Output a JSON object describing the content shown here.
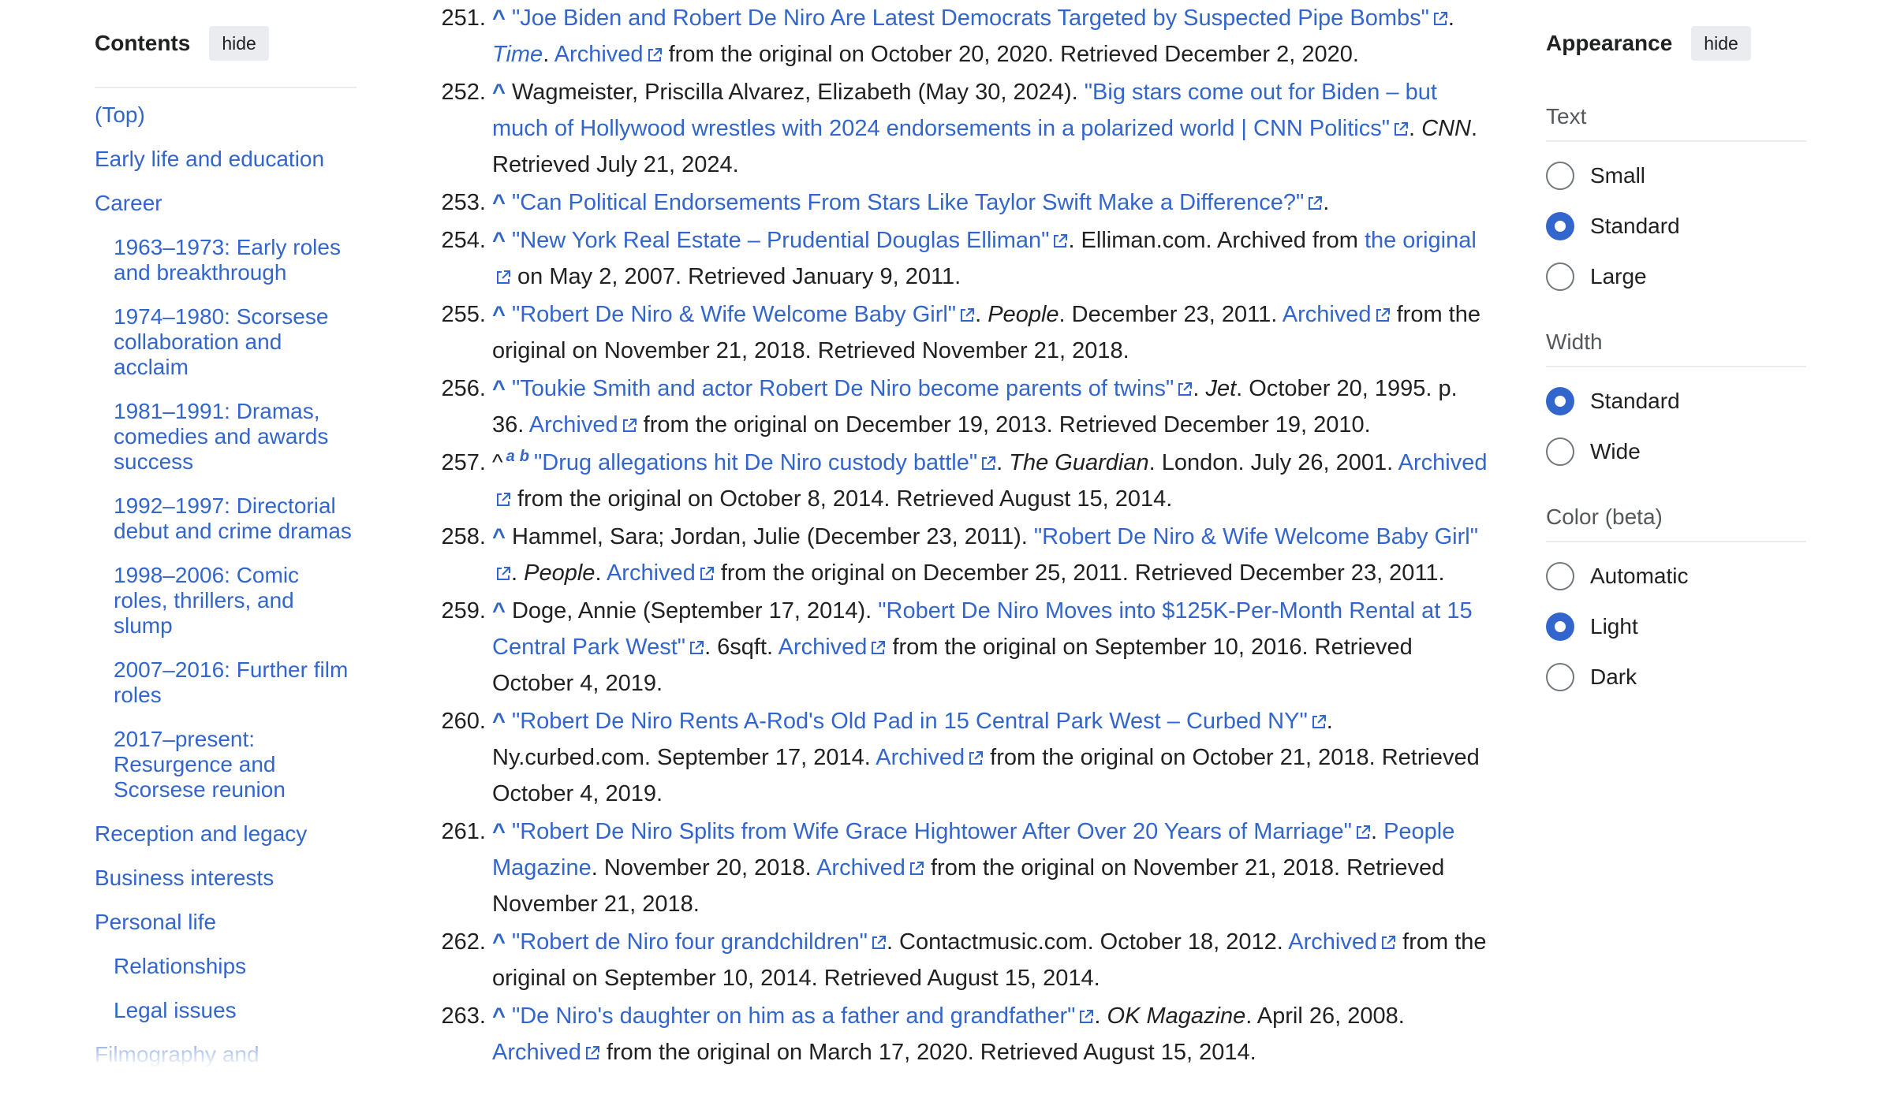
{
  "toc": {
    "title": "Contents",
    "hide_label": "hide",
    "items": [
      {
        "label": "(Top)",
        "level": 1
      },
      {
        "label": "Early life and education",
        "level": 1
      },
      {
        "label": "Career",
        "level": 1,
        "expandable": true
      },
      {
        "label": "1963–1973: Early roles and breakthrough",
        "level": 2
      },
      {
        "label": "1974–1980: Scorsese collaboration and acclaim",
        "level": 2
      },
      {
        "label": "1981–1991: Dramas, comedies and awards success",
        "level": 2
      },
      {
        "label": "1992–1997: Directorial debut and crime dramas",
        "level": 2
      },
      {
        "label": "1998–2006: Comic roles, thrillers, and slump",
        "level": 2
      },
      {
        "label": "2007–2016: Further film roles",
        "level": 2
      },
      {
        "label": "2017–present: Resurgence and Scorsese reunion",
        "level": 2
      },
      {
        "label": "Reception and legacy",
        "level": 1
      },
      {
        "label": "Business interests",
        "level": 1
      },
      {
        "label": "Personal life",
        "level": 1,
        "expandable": true
      },
      {
        "label": "Relationships",
        "level": 2
      },
      {
        "label": "Legal issues",
        "level": 2
      },
      {
        "label": "Filmography and",
        "level": 1
      }
    ]
  },
  "appearance": {
    "title": "Appearance",
    "hide_label": "hide",
    "sections": [
      {
        "label": "Text",
        "options": [
          {
            "label": "Small",
            "checked": false
          },
          {
            "label": "Standard",
            "checked": true
          },
          {
            "label": "Large",
            "checked": false
          }
        ]
      },
      {
        "label": "Width",
        "options": [
          {
            "label": "Standard",
            "checked": true
          },
          {
            "label": "Wide",
            "checked": false
          }
        ]
      },
      {
        "label": "Color (beta)",
        "options": [
          {
            "label": "Automatic",
            "checked": false
          },
          {
            "label": "Light",
            "checked": true
          },
          {
            "label": "Dark",
            "checked": false
          }
        ]
      }
    ]
  },
  "references": [
    {
      "num": "251.",
      "caret": "^",
      "segments": [
        {
          "t": "\"Joe Biden and Robert De Niro Are Latest Democrats Targeted by Suspected Pipe Bombs\"",
          "link": true,
          "ext": true
        },
        {
          "t": ". "
        },
        {
          "t": "Time",
          "link": true,
          "italic": true
        },
        {
          "t": ". "
        },
        {
          "t": "Archived",
          "link": true,
          "ext": true
        },
        {
          "t": " from the original on October 20, 2020. Retrieved December 2, 2020."
        }
      ]
    },
    {
      "num": "252.",
      "caret": "^",
      "segments": [
        {
          "t": "Wagmeister, Priscilla Alvarez, Elizabeth (May 30, 2024). "
        },
        {
          "t": "\"Big stars come out for Biden – but much of Hollywood wrestles with 2024 endorsements in a polarized world | CNN Politics\"",
          "link": true,
          "ext": true
        },
        {
          "t": ". "
        },
        {
          "t": "CNN",
          "italic": true
        },
        {
          "t": ". Retrieved July 21, 2024."
        }
      ]
    },
    {
      "num": "253.",
      "caret": "^",
      "segments": [
        {
          "t": "\"Can Political Endorsements From Stars Like Taylor Swift Make a Difference?\"",
          "link": true,
          "ext": true
        },
        {
          "t": "."
        }
      ]
    },
    {
      "num": "254.",
      "caret": "^",
      "segments": [
        {
          "t": "\"New York Real Estate – Prudential Douglas Elliman\"",
          "link": true,
          "ext": true
        },
        {
          "t": ". Elliman.com. Archived from "
        },
        {
          "t": "the original",
          "link": true,
          "ext": true
        },
        {
          "t": " on May 2, 2007. Retrieved January 9, 2011."
        }
      ]
    },
    {
      "num": "255.",
      "caret": "^",
      "segments": [
        {
          "t": "\"Robert De Niro & Wife Welcome Baby Girl\"",
          "link": true,
          "ext": true
        },
        {
          "t": ". "
        },
        {
          "t": "People",
          "italic": true
        },
        {
          "t": ". December 23, 2011. "
        },
        {
          "t": "Archived",
          "link": true,
          "ext": true
        },
        {
          "t": " from the original on November 21, 2018. Retrieved November 21, 2018."
        }
      ]
    },
    {
      "num": "256.",
      "caret": "^",
      "segments": [
        {
          "t": "\"Toukie Smith and actor Robert De Niro become parents of twins\"",
          "link": true,
          "ext": true
        },
        {
          "t": ". "
        },
        {
          "t": "Jet",
          "italic": true
        },
        {
          "t": ". October 20, 1995. p. 36. "
        },
        {
          "t": "Archived",
          "link": true,
          "ext": true
        },
        {
          "t": " from the original on December 19, 2013. Retrieved December 19, 2010."
        }
      ]
    },
    {
      "num": "257.",
      "caret": "^",
      "caret_plain": true,
      "sups": [
        "a",
        "b"
      ],
      "segments": [
        {
          "t": "\"Drug allegations hit De Niro custody battle\"",
          "link": true,
          "ext": true
        },
        {
          "t": ". "
        },
        {
          "t": "The Guardian",
          "italic": true
        },
        {
          "t": ". London. July 26, 2001. "
        },
        {
          "t": "Archived",
          "link": true,
          "ext": true
        },
        {
          "t": " from the original on October 8, 2014. Retrieved August 15, 2014."
        }
      ]
    },
    {
      "num": "258.",
      "caret": "^",
      "segments": [
        {
          "t": "Hammel, Sara; Jordan, Julie (December 23, 2011). "
        },
        {
          "t": "\"Robert De Niro & Wife Welcome Baby Girl\"",
          "link": true,
          "ext": true
        },
        {
          "t": ". "
        },
        {
          "t": "People",
          "italic": true
        },
        {
          "t": ". "
        },
        {
          "t": "Archived",
          "link": true,
          "ext": true
        },
        {
          "t": " from the original on December 25, 2011. Retrieved December 23, 2011."
        }
      ]
    },
    {
      "num": "259.",
      "caret": "^",
      "segments": [
        {
          "t": "Doge, Annie (September 17, 2014). "
        },
        {
          "t": "\"Robert De Niro Moves into $125K-Per-Month Rental at 15 Central Park West\"",
          "link": true,
          "ext": true
        },
        {
          "t": ". 6sqft. "
        },
        {
          "t": "Archived",
          "link": true,
          "ext": true
        },
        {
          "t": " from the original on September 10, 2016. Retrieved October 4, 2019."
        }
      ]
    },
    {
      "num": "260.",
      "caret": "^",
      "segments": [
        {
          "t": "\"Robert De Niro Rents A-Rod's Old Pad in 15 Central Park West – Curbed NY\"",
          "link": true,
          "ext": true
        },
        {
          "t": ". Ny.curbed.com. September 17, 2014. "
        },
        {
          "t": "Archived",
          "link": true,
          "ext": true
        },
        {
          "t": " from the original on October 21, 2018. Retrieved October 4, 2019."
        }
      ]
    },
    {
      "num": "261.",
      "caret": "^",
      "segments": [
        {
          "t": "\"Robert De Niro Splits from Wife Grace Hightower After Over 20 Years of Marriage\"",
          "link": true,
          "ext": true
        },
        {
          "t": ". "
        },
        {
          "t": "People Magazine",
          "link": true
        },
        {
          "t": ". November 20, 2018. "
        },
        {
          "t": "Archived",
          "link": true,
          "ext": true
        },
        {
          "t": " from the original on November 21, 2018. Retrieved November 21, 2018."
        }
      ]
    },
    {
      "num": "262.",
      "caret": "^",
      "segments": [
        {
          "t": "\"Robert de Niro four grandchildren\"",
          "link": true,
          "ext": true
        },
        {
          "t": ". Contactmusic.com. October 18, 2012. "
        },
        {
          "t": "Archived",
          "link": true,
          "ext": true
        },
        {
          "t": " from the original on September 10, 2014. Retrieved August 15, 2014."
        }
      ]
    },
    {
      "num": "263.",
      "caret": "^",
      "segments": [
        {
          "t": "\"De Niro's daughter on him as a father and grandfather\"",
          "link": true,
          "ext": true
        },
        {
          "t": ". "
        },
        {
          "t": "OK Magazine",
          "italic": true
        },
        {
          "t": ". April 26, 2008. "
        },
        {
          "t": "Archived",
          "link": true,
          "ext": true
        },
        {
          "t": " from the original on March 17, 2020. Retrieved August 15, 2014."
        }
      ]
    }
  ]
}
